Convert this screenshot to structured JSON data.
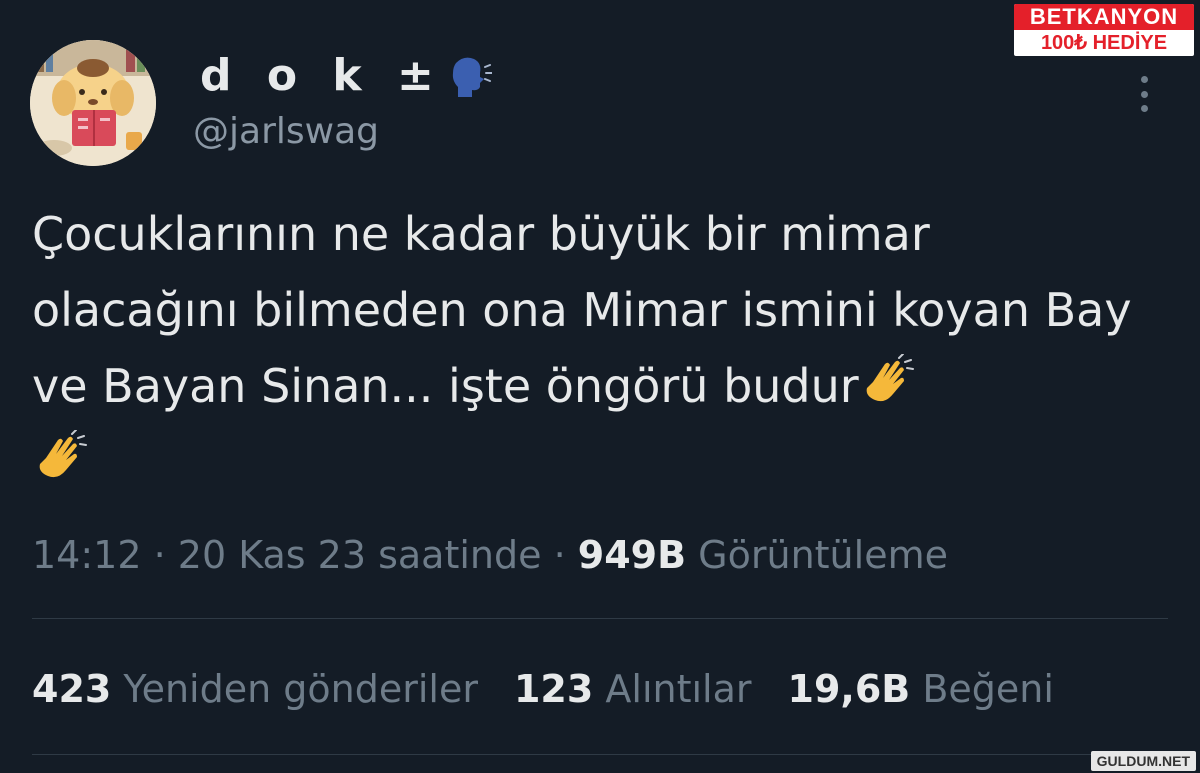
{
  "profile": {
    "display_name": "d o k ±",
    "handle": "@jarlswag"
  },
  "tweet": {
    "text": "Çocuklarının ne kadar büyük bir mimar olacağını bilmeden ona Mimar ismini koyan Bay ve Bayan Sinan... işte öngörü budur"
  },
  "meta": {
    "time": "14:12",
    "sep1": "·",
    "date": "20 Kas 23 saatinde",
    "sep2": "·",
    "views_count": "949B",
    "views_label": "Görüntüleme"
  },
  "stats": {
    "retweets_count": "423",
    "retweets_label": "Yeniden gönderiler",
    "quotes_count": "123",
    "quotes_label": "Alıntılar",
    "likes_count": "19,6B",
    "likes_label": "Beğeni"
  },
  "watermark": {
    "brand_top": "BETKANYON",
    "brand_bottom": "100₺ HEDİYE",
    "site": "GULDUM.NET"
  },
  "icons": {
    "speaking_head": "speaking-head-icon",
    "clap": "clapping-hands-icon",
    "more": "more-vertical-icon"
  },
  "colors": {
    "background": "#141c26",
    "primary_text": "#e7e9ea",
    "secondary_text": "#6e7c89",
    "handle_text": "#8b98a5",
    "brand_red": "#e4202a"
  }
}
